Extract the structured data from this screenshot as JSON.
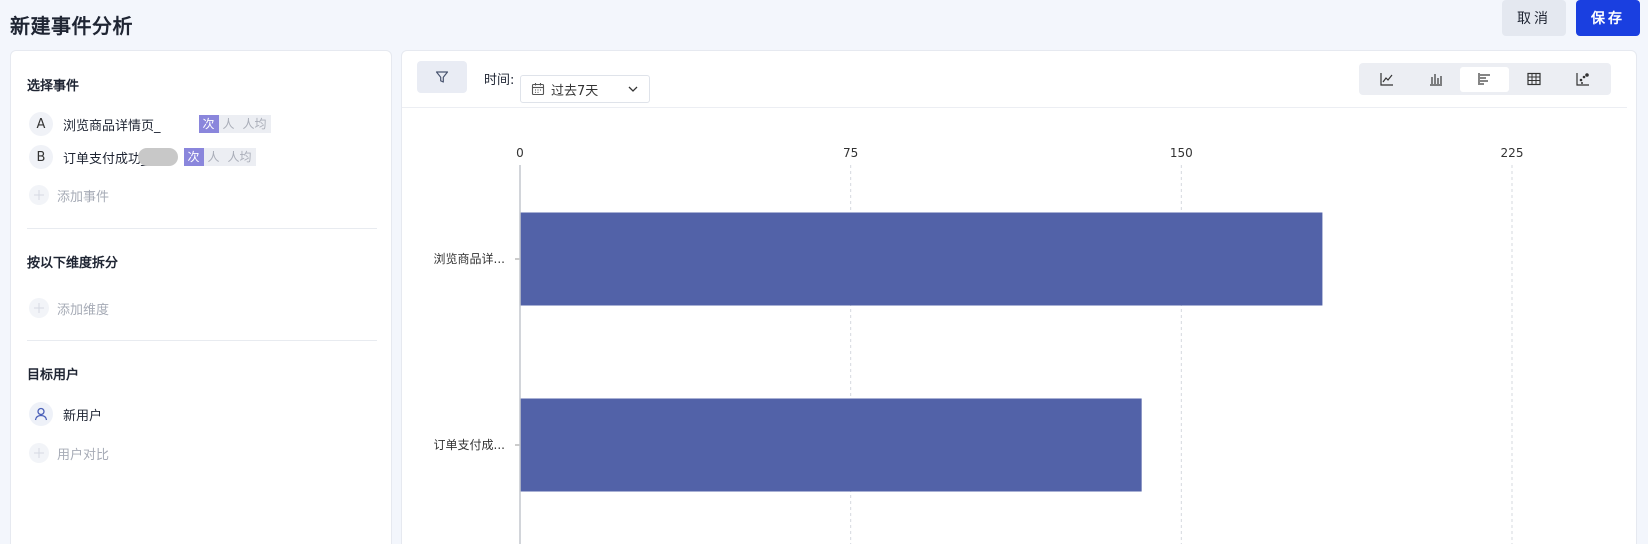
{
  "header": {
    "title": "新建事件分析",
    "cancel_label": "取消",
    "save_label": "保存"
  },
  "left_panel": {
    "events_section": {
      "title": "选择事件",
      "events": [
        {
          "letter": "A",
          "name": "浏览商品详情页_",
          "metrics": [
            "次",
            "人",
            "人均"
          ],
          "active_metric": "次"
        },
        {
          "letter": "B",
          "name": "订单支付成功_",
          "metrics": [
            "次",
            "人",
            "人均"
          ],
          "active_metric": "次"
        }
      ],
      "add_label": "添加事件"
    },
    "dimension_section": {
      "title": "按以下维度拆分",
      "add_label": "添加维度"
    },
    "target_section": {
      "title": "目标用户",
      "user_label": "新用户",
      "compare_label": "用户对比"
    }
  },
  "toolbar": {
    "time_label": "时间:",
    "time_value": "过去7天",
    "chart_types": [
      {
        "icon": "line-chart-icon",
        "active": false
      },
      {
        "icon": "bar-chart-icon",
        "active": false
      },
      {
        "icon": "horizontal-bar-chart-icon",
        "active": true
      },
      {
        "icon": "table-icon",
        "active": false
      },
      {
        "icon": "scatter-chart-icon",
        "active": false
      }
    ]
  },
  "chart_data": {
    "type": "bar",
    "orientation": "horizontal",
    "categories": [
      "浏览商品详...",
      "订单支付成..."
    ],
    "values": [
      182,
      141
    ],
    "xticks": [
      0,
      75,
      150,
      225
    ],
    "xlim": [
      0,
      225
    ],
    "grid": true,
    "bar_color": "#5262a8"
  },
  "colors": {
    "accent": "#1a3fe0",
    "bar": "#5262a8",
    "metric_active": "#8a86dc"
  }
}
